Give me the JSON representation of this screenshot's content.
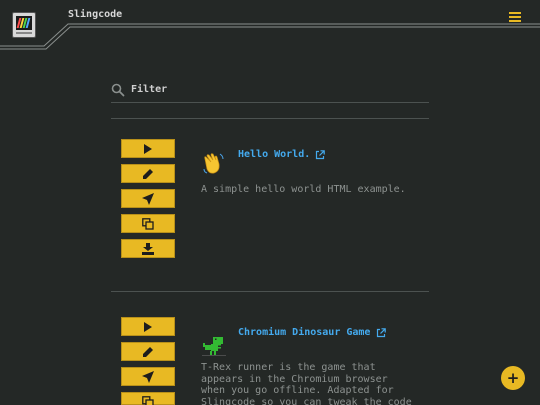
{
  "app": {
    "title": "Slingcode",
    "accent_color": "#e8b923",
    "background_color": "#242826",
    "link_color": "#44aaee"
  },
  "header": {
    "logo_icon": "computer-logo-icon",
    "menu_icon": "hamburger-menu-icon"
  },
  "filter": {
    "placeholder": "Filter",
    "value": "",
    "icon": "search-icon"
  },
  "actions": [
    "run",
    "edit",
    "send",
    "duplicate",
    "download"
  ],
  "apps": [
    {
      "title": "Hello World.",
      "icon": "waving-hand-emoji",
      "description": "A simple hello world HTML example."
    },
    {
      "title": "Chromium Dinosaur Game",
      "icon": "green-dinosaur-icon",
      "description": "T-Rex runner is the game that\nappears in the Chromium browser\nwhen you go offline. Adapted for\nSlingcode so you can tweak the code"
    }
  ],
  "fab": {
    "label": "+"
  }
}
